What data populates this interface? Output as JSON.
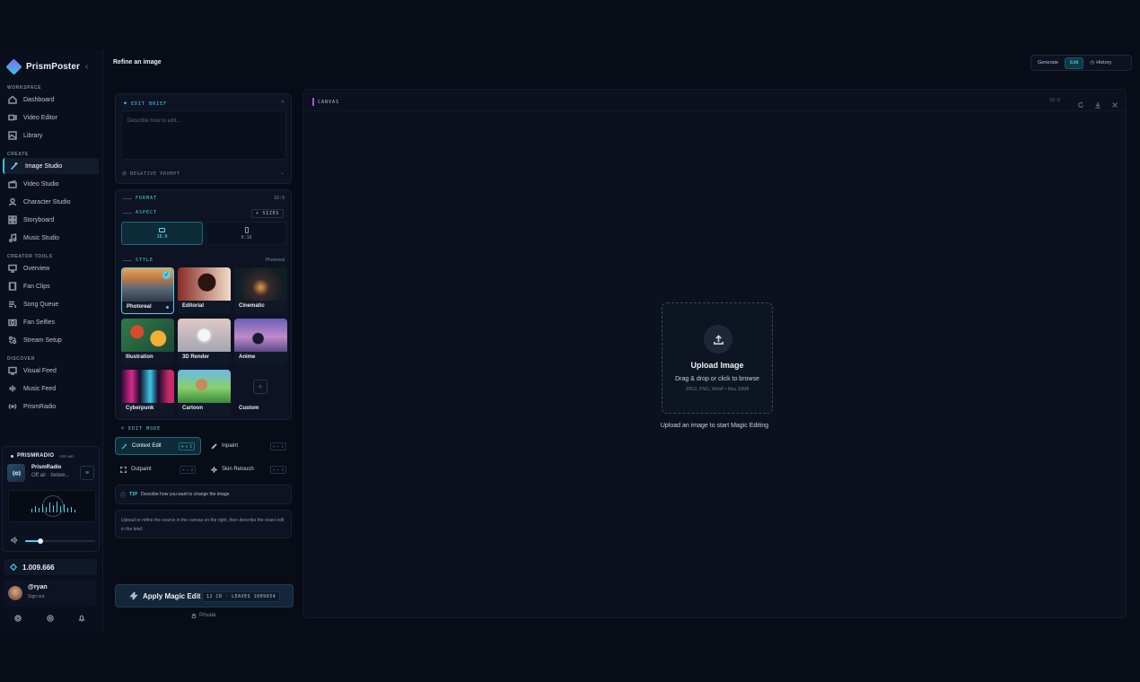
{
  "app": {
    "name": "PrismPoster",
    "collapse_glyph": "‹"
  },
  "sidebar": {
    "sections": {
      "workspace": "WORKSPACE",
      "create": "CREATE",
      "creator_tools": "CREATOR TOOLS",
      "discover": "DISCOVER"
    },
    "items": [
      {
        "label": "Dashboard",
        "icon": "home-icon"
      },
      {
        "label": "Video Editor",
        "icon": "video-icon"
      },
      {
        "label": "Library",
        "icon": "image-icon"
      },
      {
        "label": "Image Studio",
        "icon": "wand-icon",
        "active": true
      },
      {
        "label": "Video Studio",
        "icon": "clapper-icon"
      },
      {
        "label": "Character Studio",
        "icon": "user-icon"
      },
      {
        "label": "Storyboard",
        "icon": "grid-icon"
      },
      {
        "label": "Music Studio",
        "icon": "music-icon"
      },
      {
        "label": "Overview",
        "icon": "monitor-icon"
      },
      {
        "label": "Fan Clips",
        "icon": "film-icon"
      },
      {
        "label": "Song Queue",
        "icon": "list-icon"
      },
      {
        "label": "Fan Selfies",
        "icon": "camera-icon"
      },
      {
        "label": "Stream Setup",
        "icon": "settings-grid-icon"
      },
      {
        "label": "Visual Feed",
        "icon": "screen-icon"
      },
      {
        "label": "Music Feed",
        "icon": "waveform-icon"
      },
      {
        "label": "PrismRadio",
        "icon": "broadcast-icon"
      }
    ]
  },
  "radio": {
    "title": "PRISMRADIO",
    "status_badge": "OFF AIR",
    "station": "PrismRadio",
    "station_status": "Off air · betwe..."
  },
  "credits": {
    "value": "1.009.666"
  },
  "user": {
    "handle": "@ryan",
    "sign_out": "Sign out"
  },
  "header": {
    "title": "Refine an image",
    "tabs": [
      {
        "label": "Generate"
      },
      {
        "label": "Edit",
        "active": true
      },
      {
        "label": "History"
      }
    ]
  },
  "brief": {
    "title": "EDIT BRIEF",
    "placeholder": "Describe how to edit...",
    "negative_prompt": "NEGATIVE PROMPT"
  },
  "format": {
    "format_label": "FORMAT",
    "format_value": "16:9",
    "aspect_label": "ASPECT",
    "sizes_button": "+ SIZES",
    "aspects": [
      {
        "label": "16:9",
        "active": true
      },
      {
        "label": "9:16"
      }
    ],
    "style_label": "STYLE",
    "style_value": "Photoreal",
    "styles": [
      {
        "name": "Photoreal",
        "selected": true
      },
      {
        "name": "Editorial"
      },
      {
        "name": "Cinematic"
      },
      {
        "name": "Illustration"
      },
      {
        "name": "3D Render"
      },
      {
        "name": "Anime"
      },
      {
        "name": "Cyberpunk"
      },
      {
        "name": "Cartoon"
      },
      {
        "name": "Custom"
      }
    ]
  },
  "edit_mode": {
    "label": "EDIT MODE",
    "modes": [
      {
        "label": "Context Edit",
        "shortcut": "⌘ + C",
        "active": true
      },
      {
        "label": "Inpaint",
        "shortcut": "⌘ + I"
      },
      {
        "label": "Outpaint",
        "shortcut": "⌘ + O"
      },
      {
        "label": "Skin Retouch",
        "shortcut": "⌘ + S"
      }
    ]
  },
  "tip": {
    "label": "TIP",
    "text": "Describe how you want to change the image"
  },
  "note": "Upload or refine the source in the canvas on the right, then describe the exact edit in the brief.",
  "apply": {
    "label": "Apply Magic Edit",
    "cost": "12 CR · LEAVES 1009654",
    "privacy": "Private"
  },
  "canvas": {
    "label": "CANVAS",
    "ratio": "16:9",
    "upload_title": "Upload Image",
    "upload_sub": "Drag & drop or click to browse",
    "upload_formats": "JPEG, PNG, WebP • Max 10MB",
    "hint": "Upload an image to start Magic Editing"
  },
  "colors": {
    "accent": "#4ad3ee",
    "background": "#080c17",
    "canvas_marker": "#b44adf"
  }
}
